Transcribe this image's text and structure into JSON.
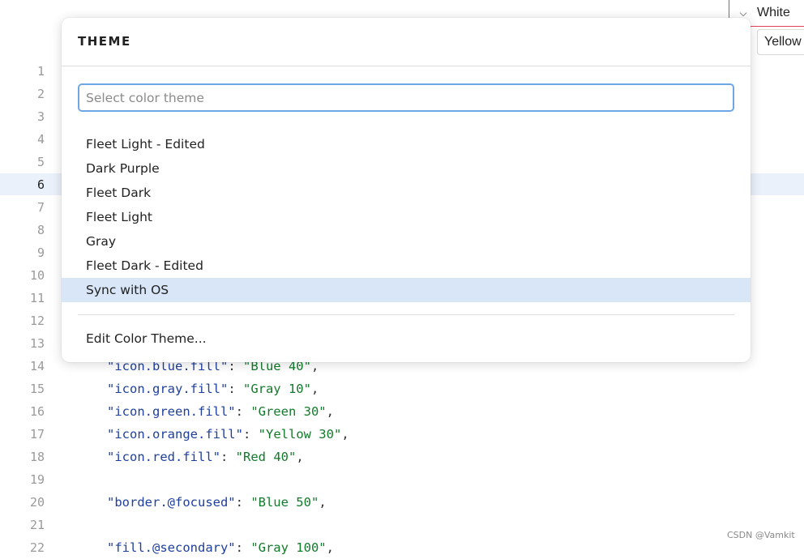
{
  "top_right": {
    "white_label": "White",
    "yellow_label": "Yellow"
  },
  "editor": {
    "active_line": 6,
    "line_numbers": [
      "1",
      "2",
      "3",
      "4",
      "5",
      "6",
      "7",
      "8",
      "9",
      "10",
      "11",
      "12",
      "13",
      "14",
      "15",
      "16",
      "17",
      "18",
      "19",
      "20",
      "21",
      "22"
    ],
    "code": [
      {
        "line": 14,
        "key": "\"icon.blue.fill\"",
        "value": "\"Blue 40\""
      },
      {
        "line": 15,
        "key": "\"icon.gray.fill\"",
        "value": "\"Gray 10\""
      },
      {
        "line": 16,
        "key": "\"icon.green.fill\"",
        "value": "\"Green 30\""
      },
      {
        "line": 17,
        "key": "\"icon.orange.fill\"",
        "value": "\"Yellow 30\""
      },
      {
        "line": 18,
        "key": "\"icon.red.fill\"",
        "value": "\"Red 40\""
      },
      {
        "line": 20,
        "key": "\"border.@focused\"",
        "value": "\"Blue 50\""
      },
      {
        "line": 22,
        "key": "\"fill.@secondary\"",
        "value": "\"Gray 100\""
      }
    ]
  },
  "theme_popup": {
    "title": "THEME",
    "search_placeholder": "Select color theme",
    "items": [
      {
        "label": "Fleet Light - Edited",
        "selected": false
      },
      {
        "label": "Dark Purple",
        "selected": false
      },
      {
        "label": "Fleet Dark",
        "selected": false
      },
      {
        "label": "Fleet Light",
        "selected": false
      },
      {
        "label": "Gray",
        "selected": false
      },
      {
        "label": "Fleet Dark - Edited",
        "selected": false
      },
      {
        "label": "Sync with OS",
        "selected": true
      }
    ],
    "edit_action": "Edit Color Theme..."
  },
  "watermark": "CSDN @Vamkit",
  "colors": {
    "selection": "#d9e6f7",
    "search_focus": "#6fa7e6",
    "line_highlight": "#eaf1fb",
    "string": "#127a2a",
    "key": "#1f3f9e"
  }
}
